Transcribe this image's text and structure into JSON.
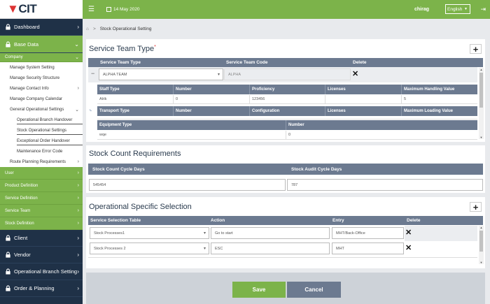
{
  "app": {
    "logo": "CIT"
  },
  "topbar": {
    "date": "14 May 2020",
    "username": "chirag",
    "language": "English"
  },
  "breadcrumb": {
    "current": "Stock Operational Setting"
  },
  "sidebar": {
    "dashboard": "Dashboard",
    "base_data": "Base Data",
    "company": "Company",
    "company_items": [
      "Manage System Setting",
      "Manage Security Structure",
      "Manage Contact Info",
      "Manage Company Calendar",
      "General Operational Settings"
    ],
    "general_sub": [
      "Operational Branch Handover",
      "Stock Operational Settings",
      "Exceptional Order Handover",
      "Maintenance Error Code"
    ],
    "route_planning": "Route Planning Requirements",
    "green_items": [
      "User",
      "Product Definition",
      "Service Definition",
      "Service Team",
      "Stock Definition"
    ],
    "bottom_items": [
      "Client",
      "Vendor",
      "Operational Branch Setting",
      "Order & Planning"
    ]
  },
  "service_team": {
    "title": "Service Team Type",
    "required_mark": "*",
    "headers": [
      "Service Team Type",
      "Service Team Code",
      "Delete"
    ],
    "row": {
      "expander": "−",
      "type": "ALPHA TEAM",
      "code": "ALPHA"
    },
    "staff_headers": [
      "Staff Type",
      "Number",
      "Proficiency",
      "Licenses",
      "Maximum Handling Value"
    ],
    "staff_row": [
      "AHk",
      "0",
      "123456",
      "",
      "5"
    ],
    "transport_headers": [
      "Transport Type",
      "Number",
      "Configuration",
      "Licenses",
      "Maximum Loading Value"
    ],
    "equipment_headers": [
      "Equipment Type",
      "Number"
    ],
    "equipment_row": [
      "wqe",
      "0"
    ]
  },
  "stock_count": {
    "title": "Stock Count Requirements",
    "headers": [
      "Stock Count Cycle Days",
      "Stock Audit Cycle Days"
    ],
    "values": [
      "545454",
      "787"
    ]
  },
  "operational": {
    "title": "Operational Specific Selection",
    "headers": [
      "Service Selection Table",
      "Action",
      "Entry",
      "Delete"
    ],
    "rows": [
      {
        "table": "Stock Processes1",
        "action": "Go to start",
        "entry": "MHT/Back-Office"
      },
      {
        "table": "Stock Processes 2",
        "action": "ESC",
        "entry": "MHT"
      }
    ]
  },
  "footer": {
    "save": "Save",
    "cancel": "Cancel"
  }
}
